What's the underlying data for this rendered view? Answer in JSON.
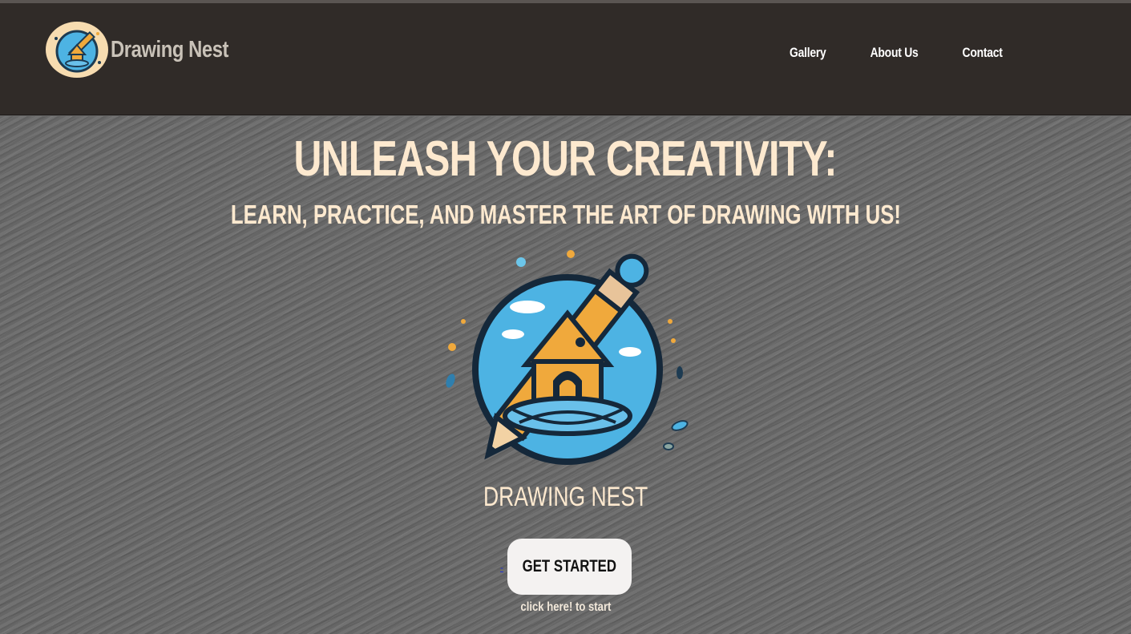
{
  "header": {
    "brand_name": "Drawing Nest",
    "nav": [
      {
        "label": "Gallery"
      },
      {
        "label": "About Us"
      },
      {
        "label": "Contact"
      }
    ]
  },
  "hero": {
    "headline": "UNLEASH YOUR CREATIVITY:",
    "subheadline": "LEARN, PRACTICE, AND MASTER THE ART OF DRAWING WITH US!",
    "brand_caption": "DRAWING NEST",
    "dash_link": "-",
    "cta_label": "GET STARTED",
    "cta_hint": "click here! to start"
  },
  "icons": {
    "brand_logo": "pencil-birdhouse-logo-icon",
    "hero_logo": "pencil-birdhouse-logo-icon"
  },
  "colors": {
    "navbar": "#302b28",
    "headline": "#fde9cf",
    "cta_bg": "#f4f2f1",
    "logo_circle": "#4db3e3",
    "logo_house": "#f0a93c"
  }
}
